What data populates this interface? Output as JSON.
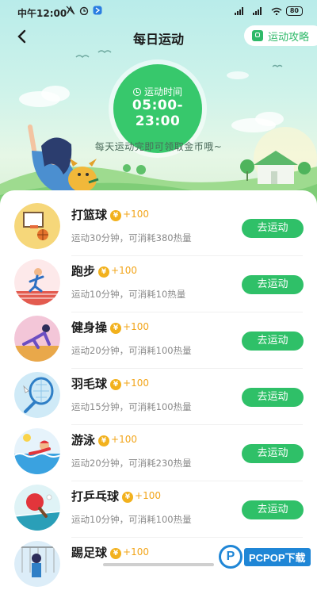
{
  "status_bar": {
    "time": "中午12:00",
    "battery": "80"
  },
  "header": {
    "title": "每日运动",
    "guide_label": "运动攻略"
  },
  "banner": {
    "time_label": "运动时间",
    "time_range": "05:00-23:00",
    "tagline": "每天运动完即可领取金币哦~"
  },
  "activities": [
    {
      "name": "打篮球",
      "coin_symbol": "¥",
      "bonus": "+100",
      "desc": "运动30分钟，可消耗380热量",
      "button": "去运动",
      "icon": "basketball-icon"
    },
    {
      "name": "跑步",
      "coin_symbol": "¥",
      "bonus": "+100",
      "desc": "运动10分钟，可消耗10热量",
      "button": "去运动",
      "icon": "running-icon"
    },
    {
      "name": "健身操",
      "coin_symbol": "¥",
      "bonus": "+100",
      "desc": "运动20分钟，可消耗100热量",
      "button": "去运动",
      "icon": "aerobics-icon"
    },
    {
      "name": "羽毛球",
      "coin_symbol": "¥",
      "bonus": "+100",
      "desc": "运动15分钟，可消耗100热量",
      "button": "去运动",
      "icon": "badminton-icon"
    },
    {
      "name": "游泳",
      "coin_symbol": "¥",
      "bonus": "+100",
      "desc": "运动20分钟，可消耗230热量",
      "button": "去运动",
      "icon": "swimming-icon"
    },
    {
      "name": "打乒乓球",
      "coin_symbol": "¥",
      "bonus": "+100",
      "desc": "运动10分钟，可消耗100热量",
      "button": "去运动",
      "icon": "table-tennis-icon"
    },
    {
      "name": "踢足球",
      "coin_symbol": "¥",
      "bonus": "+100",
      "desc": "",
      "button": "",
      "icon": "football-icon"
    }
  ],
  "watermark": {
    "logo": "P",
    "text": "PCPOP下载"
  },
  "colors": {
    "accent": "#2fc068",
    "coin": "#f2b11d",
    "hero_top": "#b9ecea"
  }
}
